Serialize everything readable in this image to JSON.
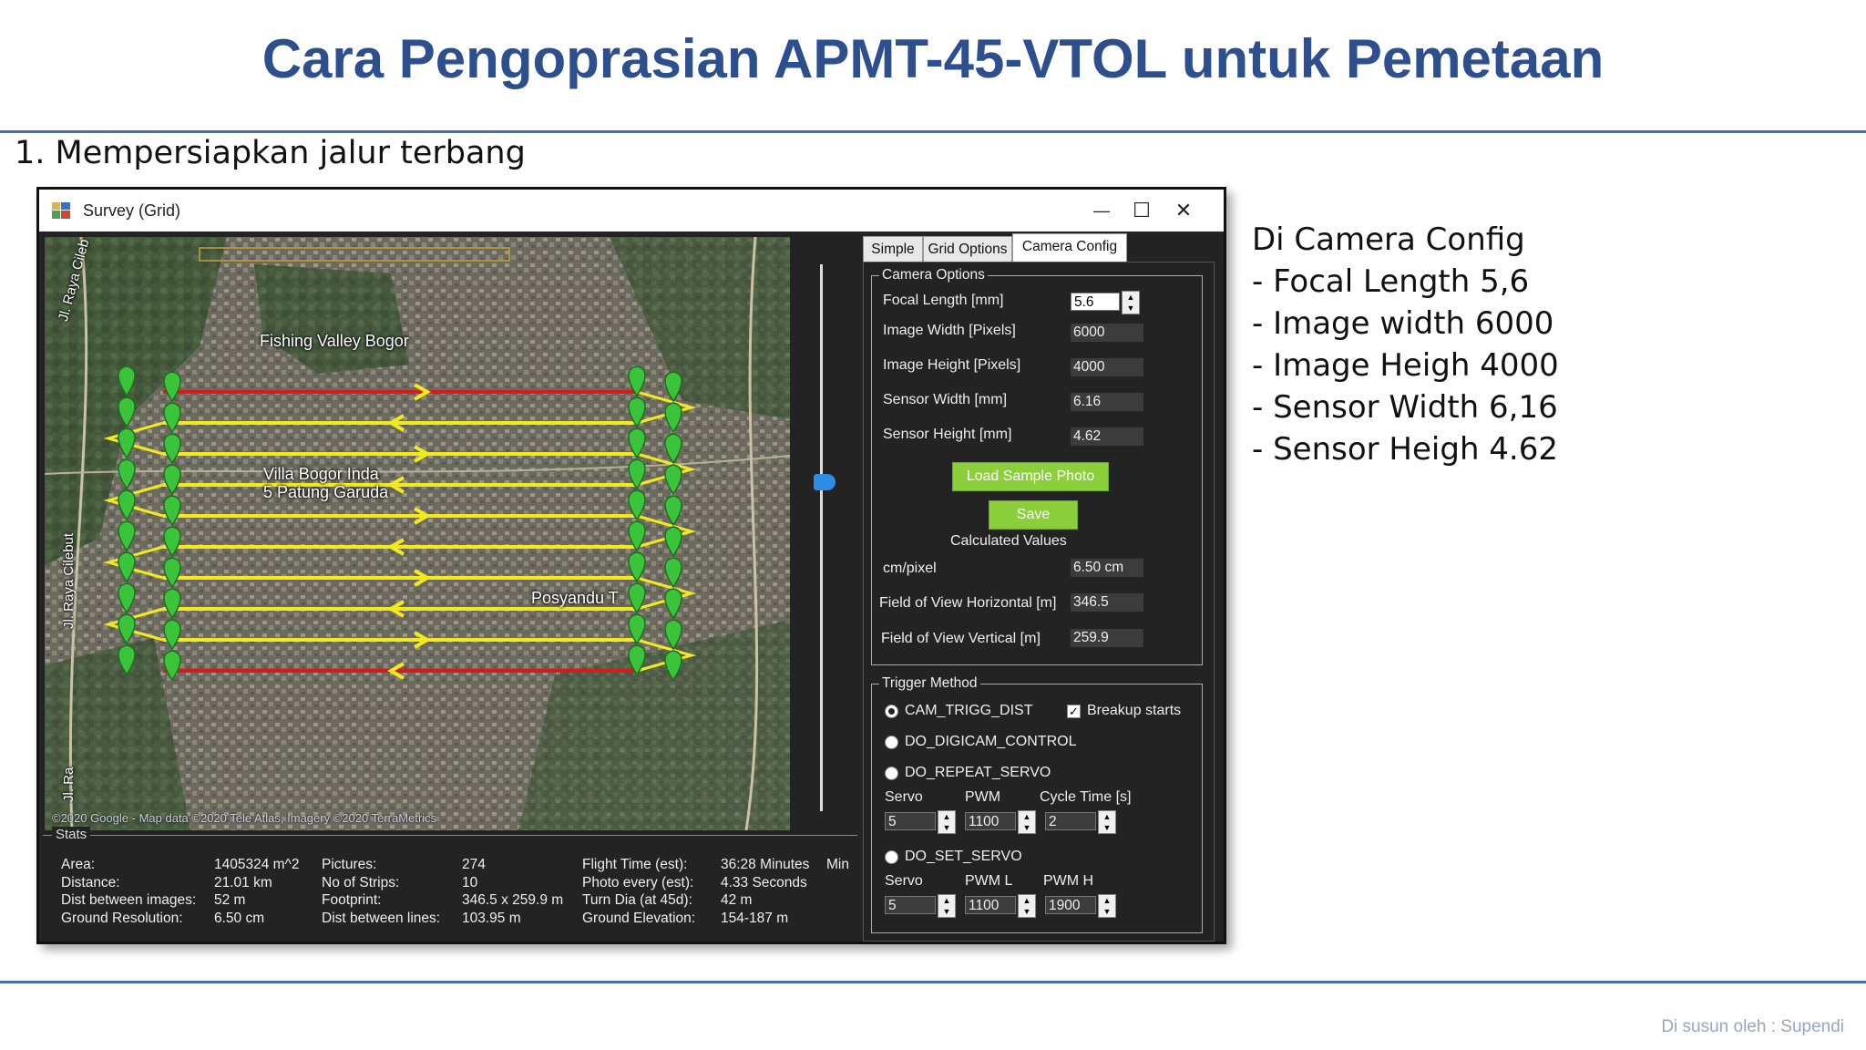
{
  "slide": {
    "title": "Cara Pengoprasian APMT-45-VTOL untuk Pemetaan",
    "step": "1. Mempersiapkan jalur terbang",
    "notes": [
      "Di Camera Config",
      "- Focal Length 5,6",
      "- Image width 6000",
      "- Image Heigh 4000",
      "- Sensor Width 6,16",
      "- Sensor Heigh 4.62"
    ],
    "footer": "Di susun oleh : Supendi"
  },
  "window": {
    "title": "Survey (Grid)",
    "minimize": "—",
    "maximize": "☐",
    "close": "✕"
  },
  "map": {
    "labels": {
      "fishing": "Fishing Valley Bogor",
      "villa1": "Villa Bogor Inda",
      "villa2": "5 Patung Garuda",
      "posyandu": "Posyandu T",
      "road1": "Jl. Raya Cileb",
      "road2": "Jl. Raya Cilebut",
      "road3": "Jl. Ra"
    },
    "copyright": "©2020 Google - Map data ©2020 Tele Atlas, Imagery ©2020 TerraMetrics",
    "strip_count": 10
  },
  "stats": {
    "legend": "Stats",
    "col1_labels": [
      "Area:",
      "Distance:",
      "Dist between images:",
      "Ground Resolution:"
    ],
    "col1_values": [
      "1405324 m^2",
      "21.01 km",
      "52 m",
      "6.50 cm"
    ],
    "col2_labels": [
      "Pictures:",
      "No of Strips:",
      "Footprint:",
      "Dist between lines:"
    ],
    "col2_values": [
      "274",
      "10",
      "346.5 x 259.9 m",
      "103.95 m"
    ],
    "col3_labels": [
      "Flight Time (est):",
      "Photo every (est):",
      "Turn Dia (at 45d):",
      "Ground Elevation:"
    ],
    "col3_values": [
      "36:28 Minutes",
      "4.33 Seconds",
      "42 m",
      "154-187 m"
    ],
    "col4": "Min"
  },
  "tabs": [
    "Simple",
    "Grid Options",
    "Camera Config"
  ],
  "camera": {
    "legend": "Camera Options",
    "focal_label": "Focal Length [mm]",
    "focal_value": "5.6",
    "imgw_label": "Image Width [Pixels]",
    "imgw_value": "6000",
    "imgh_label": "Image Height [Pixels]",
    "imgh_value": "4000",
    "sensw_label": "Sensor Width [mm]",
    "sensw_value": "6.16",
    "sensh_label": "Sensor Height [mm]",
    "sensh_value": "4.62",
    "load_button": "Load Sample Photo",
    "save_button": "Save",
    "calc_label": "Calculated Values",
    "cmpx_label": "cm/pixel",
    "cmpx_value": "6.50 cm",
    "fovh_label": "Field of View Horizontal [m]",
    "fovh_value": "346.5",
    "fovv_label": "Field of View Vertical [m]",
    "fovv_value": "259.9"
  },
  "trigger": {
    "legend": "Trigger Method",
    "opt1": "CAM_TRIGG_DIST",
    "breakup": "Breakup starts",
    "opt2": "DO_DIGICAM_CONTROL",
    "opt3": "DO_REPEAT_SERVO",
    "servo_label": "Servo",
    "pwm_label": "PWM",
    "cycle_label": "Cycle Time [s]",
    "servo_value": "5",
    "pwm_value": "1100",
    "cycle_value": "2",
    "opt4": "DO_SET_SERVO",
    "servo2_label": "Servo",
    "pwml_label": "PWM L",
    "pwmh_label": "PWM H",
    "servo2_value": "5",
    "pwml_value": "1100",
    "pwmh_value": "1900"
  },
  "colors": {
    "title": "#2e4f8e",
    "path": "#f2ea1c",
    "path_edge": "#d71a1a",
    "marker": "#3bc43b",
    "button": "#8bd03a"
  }
}
